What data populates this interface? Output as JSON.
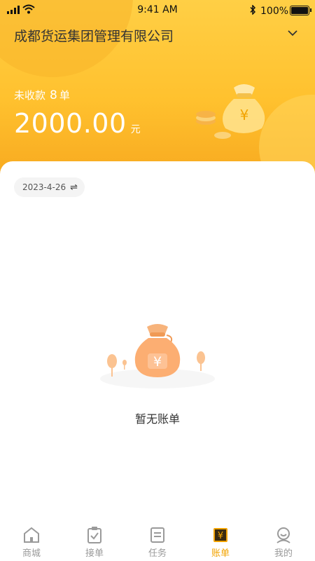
{
  "status_bar": {
    "time": "9:41 AM",
    "battery": "100%"
  },
  "header": {
    "company": "成都货运集团管理有限公司",
    "unpaid_label": "未收款",
    "unpaid_count": "8",
    "unpaid_unit": "单",
    "amount": "2000.00",
    "amount_unit": "元"
  },
  "filter": {
    "date": "2023-4-26",
    "swap_icon": "⇌"
  },
  "empty": {
    "message": "暂无账单"
  },
  "tabbar": {
    "active": "账单",
    "items": [
      {
        "label": "商城",
        "icon": "home-icon"
      },
      {
        "label": "接单",
        "icon": "clipboard-check-icon"
      },
      {
        "label": "任务",
        "icon": "document-icon"
      },
      {
        "label": "账单",
        "icon": "bill-yen-icon"
      },
      {
        "label": "我的",
        "icon": "user-icon"
      }
    ]
  },
  "colors": {
    "header_yellow": "#ffc12e",
    "accent": "#f2a300",
    "inactive": "#9a9a9a"
  }
}
